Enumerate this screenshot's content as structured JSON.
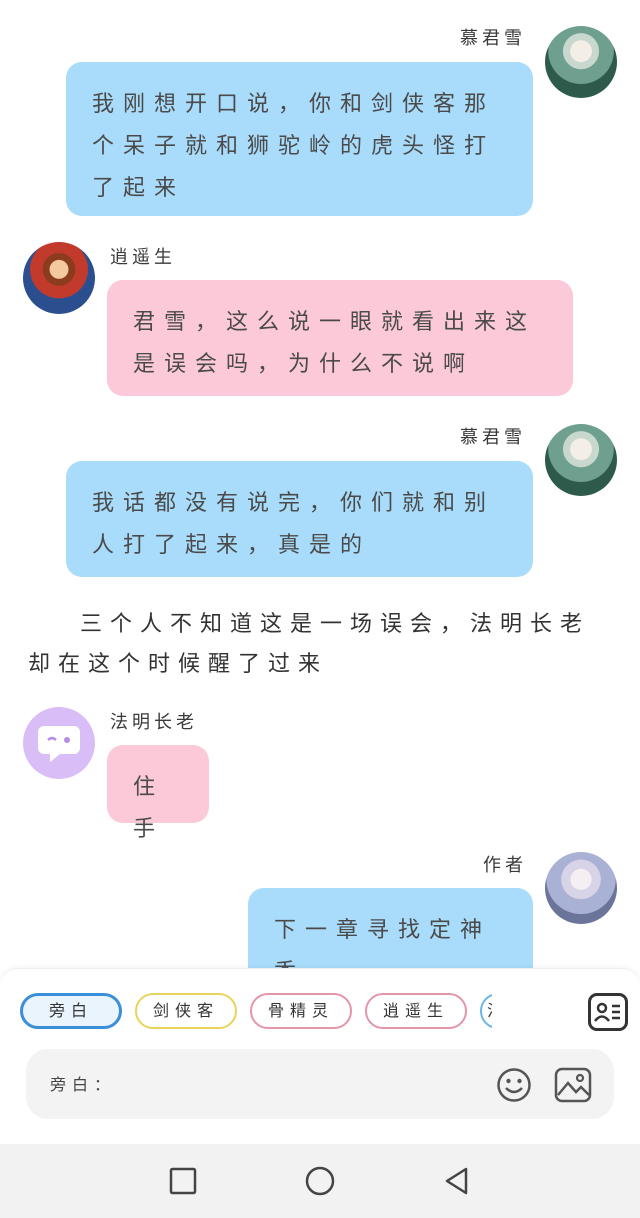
{
  "messages": [
    {
      "speaker": "慕君雪",
      "text": "我刚想开口说，你和剑侠客那个呆子就和狮驼岭的虎头怪打了起来"
    },
    {
      "speaker": "逍遥生",
      "text": "君雪，这么说一眼就看出来这是误会吗，为什么不说啊"
    },
    {
      "speaker": "慕君雪",
      "text": "我话都没有说完，你们就和别人打了起来，真是的"
    },
    {
      "speaker": "法明长老",
      "text": "住手"
    },
    {
      "speaker": "作者",
      "text": "下一章寻找定神香"
    }
  ],
  "narration": "三个人不知道这是一场误会，法明长老却在这个时候醒了过来",
  "characters": [
    "旁白",
    "剑侠客",
    "骨精灵",
    "逍遥生",
    "法明长老"
  ],
  "input": {
    "placeholder": "旁白："
  },
  "colors": {
    "bubble_blue": "#a8dcfa",
    "bubble_pink": "#fcc9d8",
    "active_chip": "#3a8fd8"
  },
  "icons": [
    "character-card-icon",
    "emoji-icon",
    "image-icon",
    "nav-recent-icon",
    "nav-home-icon",
    "nav-back-icon"
  ]
}
